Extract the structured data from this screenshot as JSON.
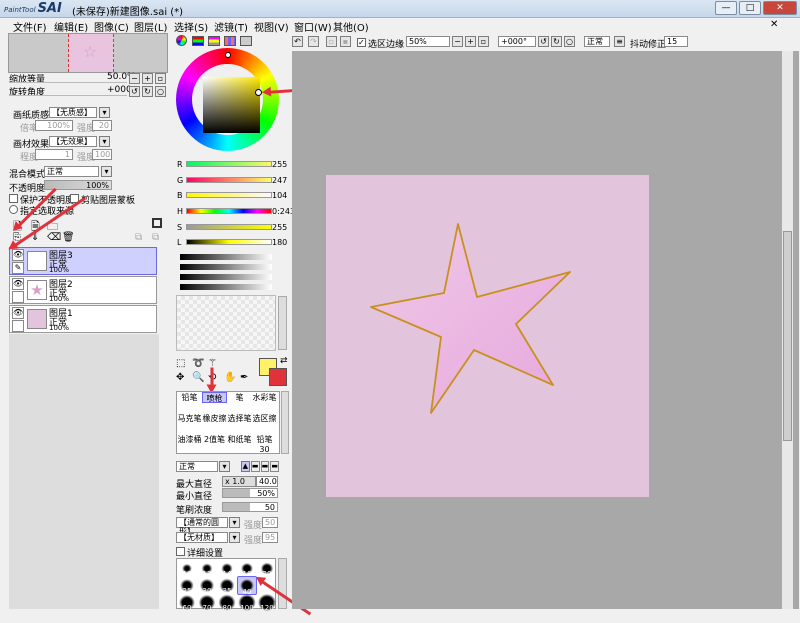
{
  "window": {
    "logo": "SAI",
    "logo_small": "PaintTool",
    "title": "(未保存)新建图像.sai (*)",
    "min": "—",
    "max": "□",
    "close": "✕"
  },
  "menu": [
    "文件(F)",
    "编辑(E)",
    "图像(C)",
    "图层(L)",
    "选择(S)",
    "滤镜(T)",
    "视图(V)",
    "窗口(W)",
    "其他(O)"
  ],
  "nav": {
    "zoom_label": "缩放等量",
    "zoom_value": "50.0%",
    "rotate_label": "旋转角度",
    "rotate_value": "+000"
  },
  "texture": {
    "paper_label": "画纸质感",
    "paper_value": "【无质感】",
    "scale_label": "倍率",
    "scale_value": "100%",
    "strength_label": "强度",
    "strength_value": "20",
    "effect_label": "画材效果",
    "effect_value": "【无效果】",
    "width_label": "程度",
    "width_value": "1",
    "strength2_value": "100"
  },
  "layerprops": {
    "blend_label": "混合模式",
    "blend_value": "正常",
    "opacity_label": "不透明度",
    "opacity_value": "100%",
    "protect": "保护不透明度",
    "clip": "剪贴图层蒙板",
    "selsource": "指定选取来源"
  },
  "layers": [
    {
      "name": "图层3",
      "mode": "正常",
      "opacity": "100%",
      "selected": true
    },
    {
      "name": "图层2",
      "mode": "正常",
      "opacity": "100%",
      "selected": false
    },
    {
      "name": "图层1",
      "mode": "正常",
      "opacity": "100%",
      "selected": false
    }
  ],
  "color": {
    "r": {
      "label": "R",
      "value": "255"
    },
    "g": {
      "label": "G",
      "value": "247"
    },
    "b": {
      "label": "B",
      "value": "104"
    },
    "h": {
      "label": "H",
      "value": "0:243"
    },
    "s": {
      "label": "S",
      "value": "255"
    },
    "l": {
      "label": "L",
      "value": "180"
    }
  },
  "tools": [
    [
      "铅笔",
      "喷枪",
      "笔",
      "水彩笔"
    ],
    [
      "马克笔",
      "橡皮擦",
      "选择笔",
      "选区擦"
    ],
    [
      "油漆桶",
      "2值笔",
      "和纸笔",
      "铅笔30"
    ]
  ],
  "brush": {
    "mode": "正常",
    "max_label": "最大直径",
    "max_mult": "x 1.0",
    "max_value": "40.0",
    "min_label": "最小直径",
    "min_value": "50%",
    "density_label": "笔刷浓度",
    "density_value": "50",
    "shape": "【通常的圆形】",
    "shape_strength": "强度",
    "shape_strength_val": "50",
    "texture": "【无材质】",
    "tex_strength": "强度",
    "tex_strength_val": "95",
    "detail": "详细设置"
  },
  "sizes": [
    [
      "10",
      "12",
      "14",
      "16",
      "20"
    ],
    [
      "25",
      "30",
      "35",
      "40",
      ""
    ],
    [
      "60",
      "70",
      "80",
      "100",
      "120"
    ]
  ],
  "canvas_toolbar": {
    "selection_edge": "选区边缘",
    "zoom": "50%",
    "rotate": "+000°",
    "mode": "正常",
    "stabilizer_label": "抖动修正",
    "stabilizer_value": "15"
  },
  "colors": {
    "fg": "#fff268",
    "bg": "#e0323a",
    "canvas": "#e2c4dd",
    "star_fill": "#e8b8e0",
    "star_stroke": "#c8901e",
    "accent_arrow": "#e0323a"
  }
}
